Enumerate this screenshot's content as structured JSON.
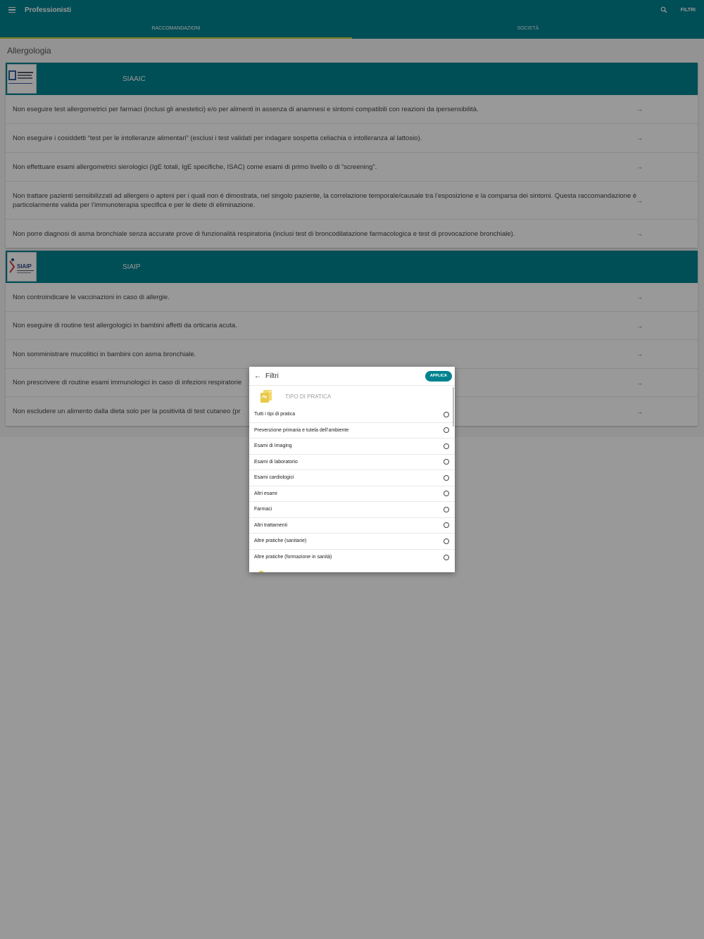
{
  "app_bar": {
    "title": "Professionisti",
    "filter_label": "FILTRI",
    "tabs": [
      {
        "label": "RACCOMANDAZIONI"
      },
      {
        "label": "SOCIETÀ"
      }
    ]
  },
  "main": {
    "section_title": "Allergologia",
    "cards": [
      {
        "name": "SIAAIC",
        "logo_text": "SIAAIC",
        "recommendations": [
          "Non eseguire test allergometrici per farmaci (inclusi gli anestetici) e/o per alimenti in assenza di anamnesi e sintomi compatibili con reazioni da ipersensibilità.",
          "Non eseguire i cosiddetti “test per le intolleranze alimentari” (esclusi i test validati per indagare sospetta celiachia o intolleranza al lattosio).",
          "Non effettuare esami allergometrici sierologici (IgE totali, IgE specifiche, ISAC) come esami di primo livello o di “screening”.",
          "Non trattare pazienti sensibilizzati ad allergeni o apteni per i quali non è dimostrata, nel singolo paziente, la correlazione temporale/causale tra l’esposizione e la comparsa dei sintomi. Questa raccomandazione è particolarmente valida per l’immunoterapia specifica e per le diete di eliminazione.",
          "Non porre diagnosi di asma bronchiale senza accurate prove di funzionalità respiratoria (inclusi test di broncodilatazione farmacologica e test di provocazione bronchiale)."
        ]
      },
      {
        "name": "SIAIP",
        "logo_text": "SIAIP",
        "recommendations": [
          "Non controindicare le vaccinazioni in caso di allergie.",
          "Non eseguire di routine test allergologici in bambini affetti da orticaria acuta.",
          "Non somministrare mucolitici in bambini con asma bronchiale.",
          "Non prescrivere di routine esami immunologici in caso di infezioni respiratorie",
          "Non escludere un alimento dalla dieta solo per la positività di test cutaneo (pr"
        ]
      }
    ]
  },
  "dialog": {
    "title": "Filtri",
    "apply_label": "APPLICA",
    "section_label": "TIPO DI PRATICA",
    "options": [
      "Tutti i tipi di pratica",
      "Prevenzione primaria e tutela dell’ambiente",
      "Esami di Imaging",
      "Esami di laboratorio",
      "Esami cardiologici",
      "Altri esami",
      "Farmaci",
      "Altri trattamenti",
      "Altre pratiche (sanitarie)",
      "Altre pratiche (formazione in sanità)"
    ]
  },
  "colors": {
    "primary": "#00838f",
    "tab_indicator": "#c8d23a",
    "icon_yellow": "#e8c94a"
  },
  "icons": {
    "menu": "menu-icon",
    "search": "search-icon",
    "arrow": "arrow-right-icon",
    "back": "arrow-left-icon",
    "pratica": "document-icon"
  }
}
